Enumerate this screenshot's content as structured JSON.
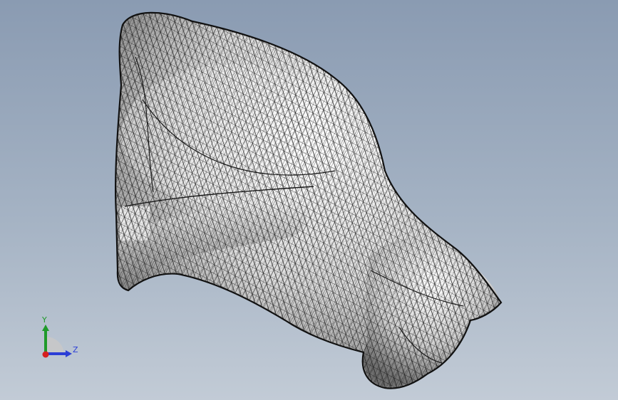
{
  "viewport": {
    "background_top": "#8a9bb2",
    "background_bottom": "#c2cbd6",
    "model": {
      "description_icon": "mesh-cat-model",
      "surface_color": "#ededed",
      "mesh_line_color": "#1a1a1a",
      "render_mode": "shaded-with-edges"
    }
  },
  "triad": {
    "y_label": "Y",
    "z_label": "Z",
    "y_color": "#1f9a2a",
    "z_color": "#2b3ed6",
    "x_color": "#d62020"
  }
}
